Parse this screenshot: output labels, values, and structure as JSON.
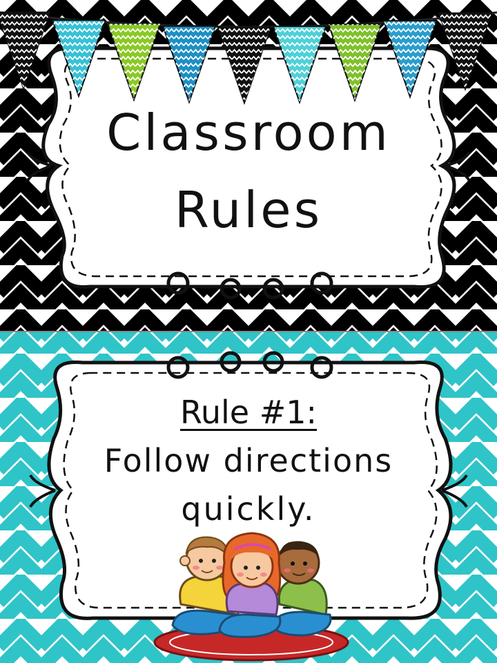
{
  "title_card": {
    "line1": "Classroom",
    "line2": "Rules",
    "background_color": "#000000"
  },
  "rule_card": {
    "heading": "Rule #1:",
    "line1": "Follow directions",
    "line2": "quickly.",
    "background_color": "#2fc4c8"
  },
  "bunting_colors": [
    "#111111",
    "#37c1d6",
    "#8ac926",
    "#1d8fc4",
    "#111111",
    "#4fd0d8",
    "#7fc12a",
    "#2a9dcc",
    "#111111"
  ],
  "illustration": {
    "name": "three-children-sitting-on-rug",
    "children_shirt_colors": [
      "#f5d33a",
      "#b58ad8",
      "#8cc04a"
    ],
    "rug_color": "#c62828"
  }
}
